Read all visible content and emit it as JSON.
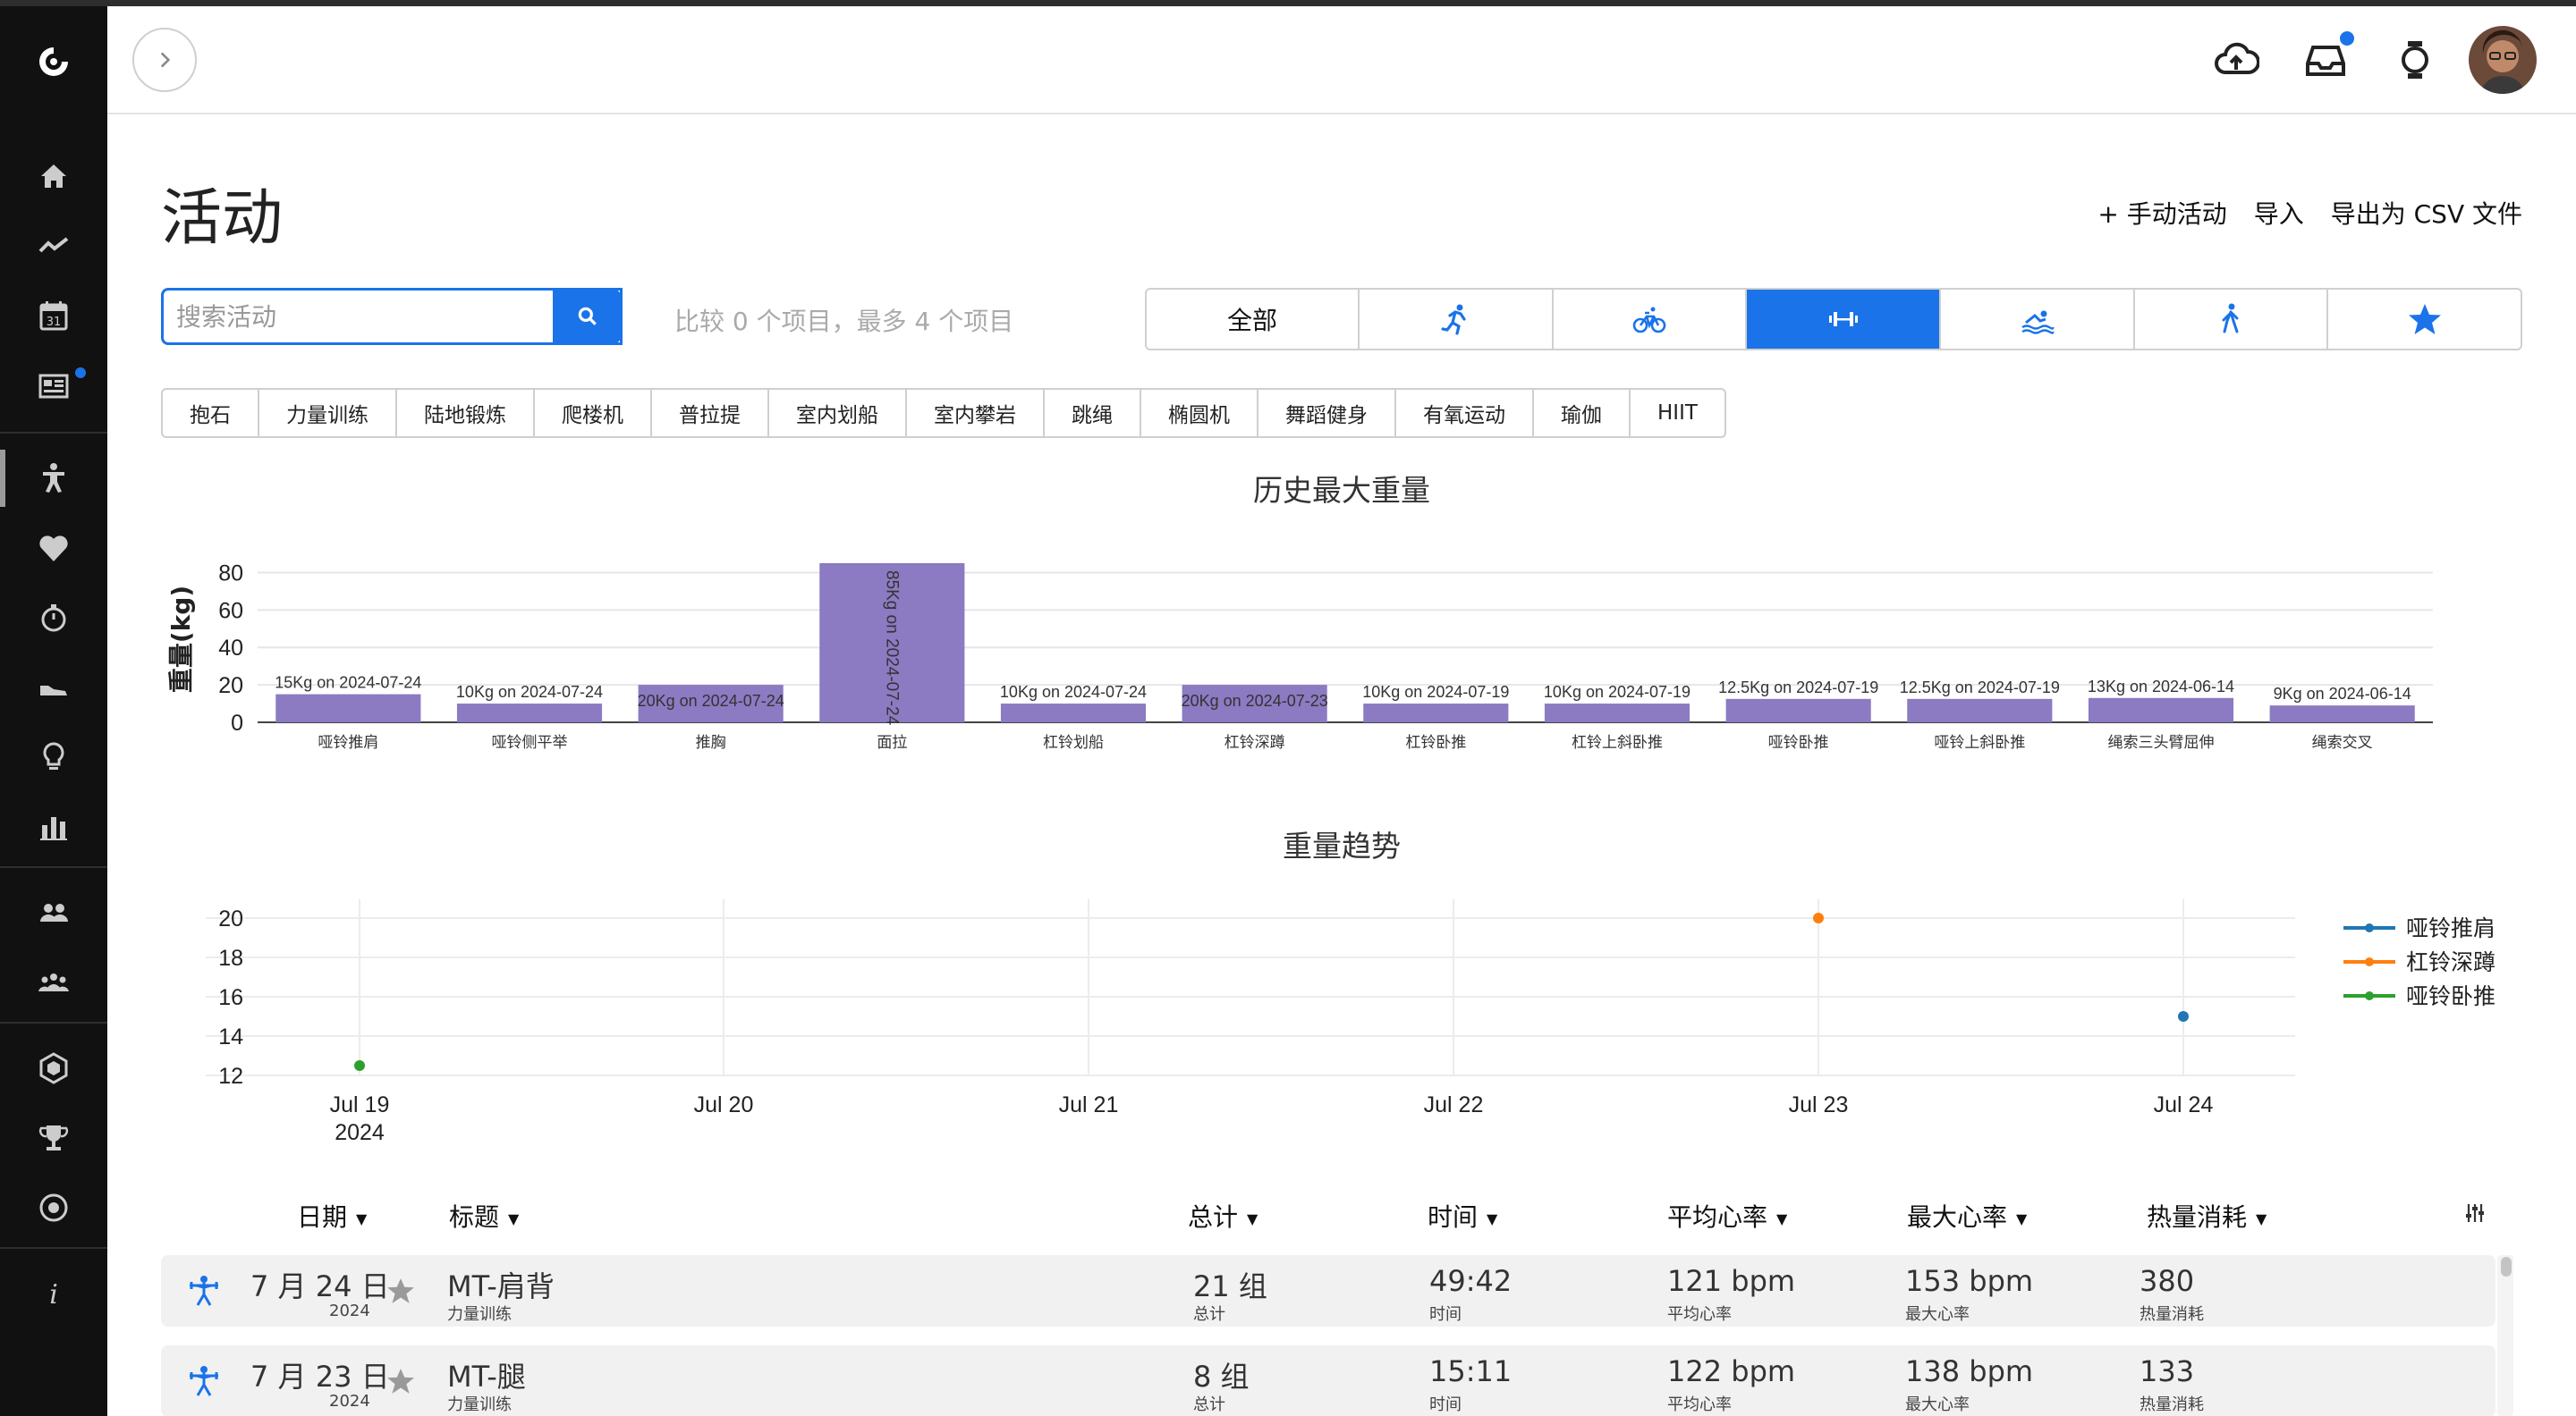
{
  "colors": {
    "accent": "#1a73e8",
    "bar": "#8c7ac2",
    "series_blue": "#1f77b4",
    "series_orange": "#ff7f0e",
    "series_green": "#2ca02c"
  },
  "sidebar": {
    "items": [
      {
        "icon": "logo-icon"
      },
      {
        "icon": "home-icon"
      },
      {
        "icon": "activity-trend-icon"
      },
      {
        "icon": "calendar-icon",
        "label": "31"
      },
      {
        "icon": "news-icon"
      },
      {
        "icon": "activity-person-icon"
      },
      {
        "icon": "heart-icon"
      },
      {
        "icon": "stopwatch-icon"
      },
      {
        "icon": "shoe-icon"
      },
      {
        "icon": "lightbulb-icon"
      },
      {
        "icon": "bar-chart-icon"
      },
      {
        "icon": "connections-icon"
      },
      {
        "icon": "groups-icon"
      },
      {
        "icon": "badge-icon"
      },
      {
        "icon": "trophy-icon"
      },
      {
        "icon": "target-icon"
      },
      {
        "icon": "info-icon",
        "label": "i"
      }
    ]
  },
  "header": {
    "icons": [
      "upload-cloud-icon",
      "inbox-icon",
      "watch-icon",
      "avatar"
    ]
  },
  "page": {
    "title": "活动",
    "actions": {
      "manual": "+ 手动活动",
      "import": "导入",
      "export": "导出为 CSV 文件"
    }
  },
  "search": {
    "placeholder": "搜索活动",
    "compare_text": "比较 0 个项目，最多 4 个项目"
  },
  "type_tabs": [
    {
      "label": "全部",
      "icon": ""
    },
    {
      "label": "",
      "icon": "running-icon"
    },
    {
      "label": "",
      "icon": "cycling-icon"
    },
    {
      "label": "",
      "icon": "strength-icon",
      "active": true
    },
    {
      "label": "",
      "icon": "swimming-icon"
    },
    {
      "label": "",
      "icon": "walking-icon"
    },
    {
      "label": "",
      "icon": "star-icon"
    }
  ],
  "sub_filters": [
    "抱石",
    "力量训练",
    "陆地锻炼",
    "爬楼机",
    "普拉提",
    "室内划船",
    "室内攀岩",
    "跳绳",
    "椭圆机",
    "舞蹈健身",
    "有氧运动",
    "瑜伽",
    "HIIT"
  ],
  "chart_data": [
    {
      "type": "bar",
      "title": "历史最大重量",
      "ylabel": "重量(kg)",
      "xlabel": "",
      "ylim": [
        0,
        85
      ],
      "yticks": [
        0,
        20,
        40,
        60,
        80
      ],
      "categories": [
        "哑铃推肩",
        "哑铃侧平举",
        "推胸",
        "面拉",
        "杠铃划船",
        "杠铃深蹲",
        "杠铃卧推",
        "杠铃上斜卧推",
        "哑铃卧推",
        "哑铃上斜卧推",
        "绳索三头臂屈伸",
        "绳索交叉"
      ],
      "values": [
        15,
        10,
        20,
        85,
        10,
        20,
        10,
        10,
        12.5,
        12.5,
        13,
        9
      ],
      "data_labels": [
        "15Kg on 2024-07-24",
        "10Kg on 2024-07-24",
        "20Kg on 2024-07-24",
        "85Kg on 2024-07-24",
        "10Kg on 2024-07-24",
        "20Kg on 2024-07-23",
        "10Kg on 2024-07-19",
        "10Kg on 2024-07-19",
        "12.5Kg on 2024-07-19",
        "12.5Kg on 2024-07-19",
        "13Kg on 2024-06-14",
        "9Kg on 2024-06-14"
      ],
      "grid": true
    },
    {
      "type": "line",
      "title": "重量趋势",
      "xlabel": "",
      "ylabel": "",
      "x_ticks": [
        "Jul 19",
        "Jul 20",
        "Jul 21",
        "Jul 22",
        "Jul 23",
        "Jul 24"
      ],
      "x_year_label": "2024",
      "xlim": [
        "2024-07-19",
        "2024-07-24"
      ],
      "ylim": [
        12,
        20.6
      ],
      "yticks": [
        12,
        14,
        16,
        18,
        20
      ],
      "grid": true,
      "legend_position": "right",
      "series": [
        {
          "name": "哑铃推肩",
          "color": "#1f77b4",
          "points": [
            {
              "x": "2024-07-24",
              "y": 15
            }
          ]
        },
        {
          "name": "杠铃深蹲",
          "color": "#ff7f0e",
          "points": [
            {
              "x": "2024-07-23",
              "y": 20
            }
          ]
        },
        {
          "name": "哑铃卧推",
          "color": "#2ca02c",
          "points": [
            {
              "x": "2024-07-19",
              "y": 12.5
            }
          ]
        }
      ]
    }
  ],
  "table": {
    "headers": {
      "date": "日期",
      "title": "标题",
      "total": "总计",
      "time": "时间",
      "avg_hr": "平均心率",
      "max_hr": "最大心率",
      "calories": "热量消耗"
    },
    "rows": [
      {
        "date": "7 月 24 日",
        "year": "2024",
        "title": "MT-肩背",
        "type": "力量训练",
        "total": "21 组",
        "total_label": "总计",
        "time": "49:42",
        "time_label": "时间",
        "avg_hr": "121 bpm",
        "avg_hr_label": "平均心率",
        "max_hr": "153 bpm",
        "max_hr_label": "最大心率",
        "calories": "380",
        "calories_label": "热量消耗"
      },
      {
        "date": "7 月 23 日",
        "year": "2024",
        "title": "MT-腿",
        "type": "力量训练",
        "total": "8 组",
        "total_label": "总计",
        "time": "15:11",
        "time_label": "时间",
        "avg_hr": "122 bpm",
        "avg_hr_label": "平均心率",
        "max_hr": "138 bpm",
        "max_hr_label": "最大心率",
        "calories": "133",
        "calories_label": "热量消耗"
      }
    ]
  }
}
